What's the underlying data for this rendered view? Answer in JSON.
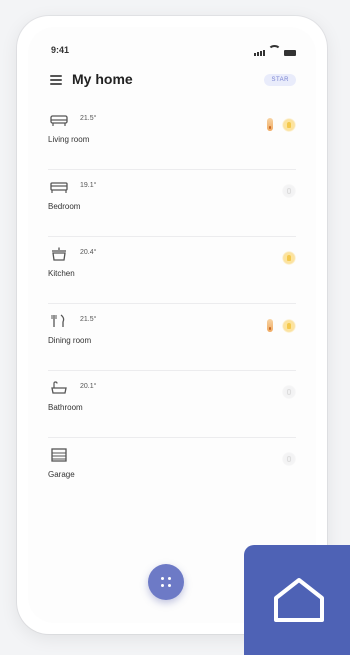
{
  "status_bar": {
    "time": "9:41"
  },
  "header": {
    "title": "My home",
    "badge": "STAR"
  },
  "rooms": [
    {
      "name": "Living room",
      "temp": "21.5°",
      "icon": "sofa-icon",
      "heating": true,
      "light_on": true
    },
    {
      "name": "Bedroom",
      "temp": "19.1°",
      "icon": "bed-icon",
      "heating": false,
      "light_on": false
    },
    {
      "name": "Kitchen",
      "temp": "20.4°",
      "icon": "pot-icon",
      "heating": false,
      "light_on": true
    },
    {
      "name": "Dining room",
      "temp": "21.5°",
      "icon": "cutlery-icon",
      "heating": true,
      "light_on": true
    },
    {
      "name": "Bathroom",
      "temp": "20.1°",
      "icon": "bathtub-icon",
      "heating": false,
      "light_on": false
    },
    {
      "name": "Garage",
      "temp": "",
      "icon": "garage-icon",
      "heating": false,
      "light_on": false
    }
  ],
  "colors": {
    "accent": "#6d7ac6",
    "tile": "#4e62b5",
    "badge_bg": "#e9ecfb",
    "bulb_on": "#f4c84d"
  }
}
